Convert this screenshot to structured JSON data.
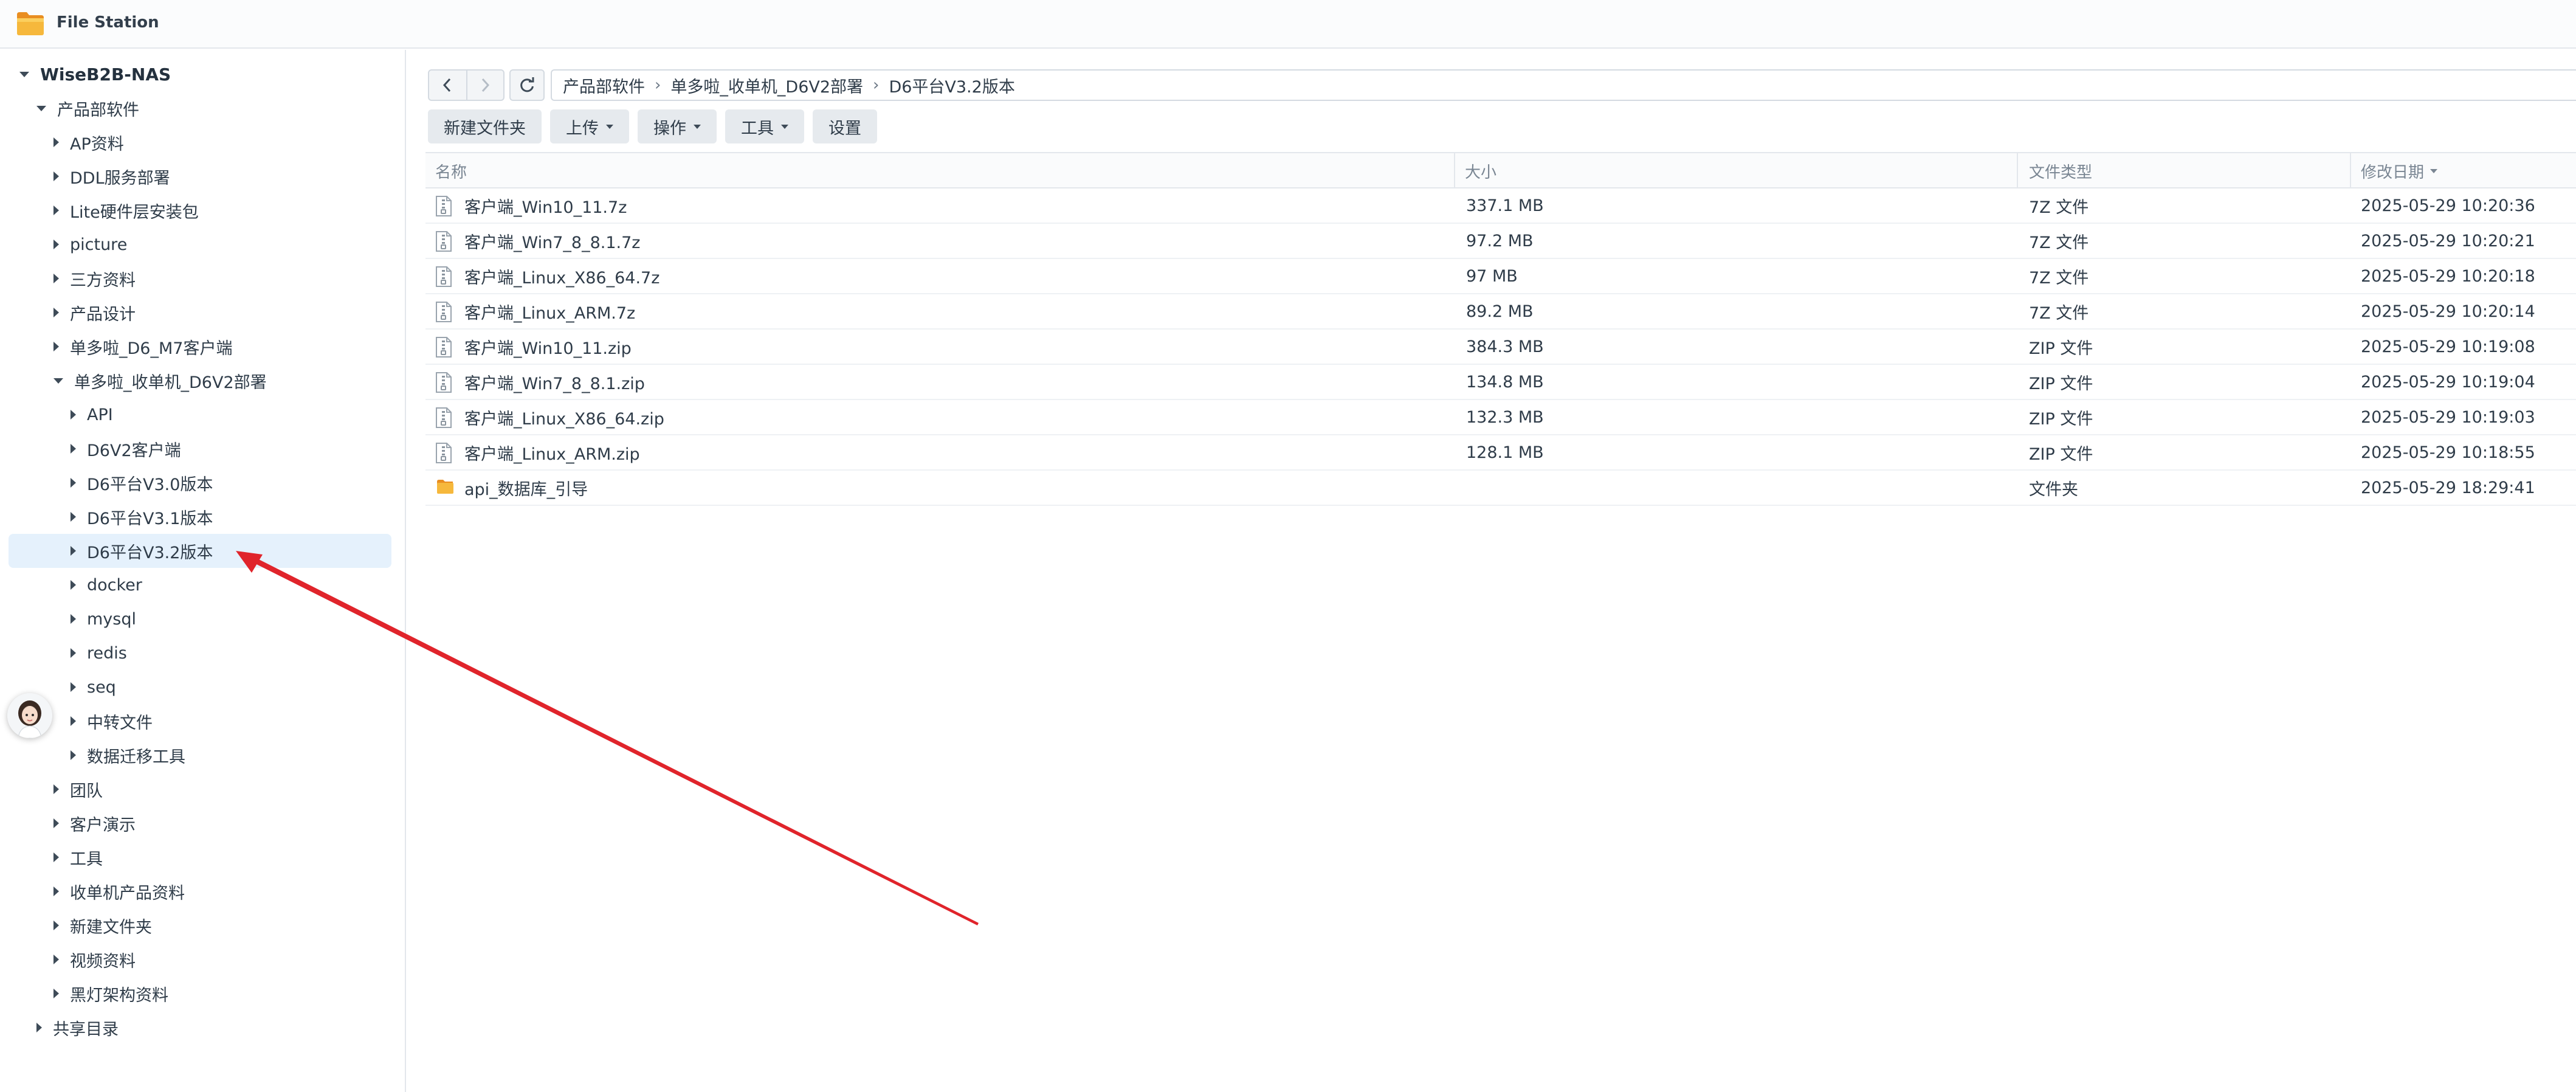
{
  "app": {
    "title": "File Station",
    "icon": "folder-icon",
    "accent_color": "#f3a33b",
    "selection_color": "#e5f1fc",
    "annotation_color": "#e0242b"
  },
  "sidebar": {
    "root": "WiseB2B-NAS",
    "items": [
      {
        "label": "产品部软件",
        "state": "expanded"
      },
      {
        "label": "AP资料",
        "state": "collapsed"
      },
      {
        "label": "DDL服务部署",
        "state": "collapsed"
      },
      {
        "label": "Lite硬件层安装包",
        "state": "collapsed"
      },
      {
        "label": "picture",
        "state": "collapsed"
      },
      {
        "label": "三方资料",
        "state": "collapsed"
      },
      {
        "label": "产品设计",
        "state": "collapsed"
      },
      {
        "label": "单多啦_D6_M7客户端",
        "state": "collapsed"
      },
      {
        "label": "单多啦_收单机_D6V2部署",
        "state": "expanded"
      },
      {
        "label": "API",
        "state": "collapsed"
      },
      {
        "label": "D6V2客户端",
        "state": "collapsed"
      },
      {
        "label": "D6平台V3.0版本",
        "state": "collapsed"
      },
      {
        "label": "D6平台V3.1版本",
        "state": "collapsed"
      },
      {
        "label": "D6平台V3.2版本",
        "state": "collapsed",
        "selected": true
      },
      {
        "label": "docker",
        "state": "collapsed"
      },
      {
        "label": "mysql",
        "state": "collapsed"
      },
      {
        "label": "redis",
        "state": "collapsed"
      },
      {
        "label": "seq",
        "state": "collapsed"
      },
      {
        "label": "中转文件",
        "state": "collapsed"
      },
      {
        "label": "数据迁移工具",
        "state": "collapsed"
      },
      {
        "label": "团队",
        "state": "collapsed"
      },
      {
        "label": "客户演示",
        "state": "collapsed"
      },
      {
        "label": "工具",
        "state": "collapsed"
      },
      {
        "label": "收单机产品资料",
        "state": "collapsed"
      },
      {
        "label": "新建文件夹",
        "state": "collapsed"
      },
      {
        "label": "视频资料",
        "state": "collapsed"
      },
      {
        "label": "黑灯架构资料",
        "state": "collapsed"
      },
      {
        "label": "共享目录",
        "state": "collapsed"
      }
    ]
  },
  "toolbar": {
    "back_icon": "chevron-left-icon",
    "forward_icon": "chevron-right-icon",
    "refresh_icon": "refresh-icon",
    "breadcrumb": [
      "产品部软件",
      "单多啦_收单机_D6V2部署",
      "D6平台V3.2版本"
    ],
    "actions": [
      {
        "label": "新建文件夹",
        "dropdown": false
      },
      {
        "label": "上传",
        "dropdown": true
      },
      {
        "label": "操作",
        "dropdown": true
      },
      {
        "label": "工具",
        "dropdown": true
      },
      {
        "label": "设置",
        "dropdown": false
      }
    ]
  },
  "table": {
    "columns": [
      "名称",
      "大小",
      "文件类型",
      "修改日期"
    ],
    "sort_column": "修改日期",
    "rows": [
      {
        "name": "客户端_Win10_11.7z",
        "size": "337.1 MB",
        "type": "7Z 文件",
        "modified": "2025-05-29 10:20:36",
        "icon": "archive-file-icon"
      },
      {
        "name": "客户端_Win7_8_8.1.7z",
        "size": "97.2 MB",
        "type": "7Z 文件",
        "modified": "2025-05-29 10:20:21",
        "icon": "archive-file-icon"
      },
      {
        "name": "客户端_Linux_X86_64.7z",
        "size": "97 MB",
        "type": "7Z 文件",
        "modified": "2025-05-29 10:20:18",
        "icon": "archive-file-icon"
      },
      {
        "name": "客户端_Linux_ARM.7z",
        "size": "89.2 MB",
        "type": "7Z 文件",
        "modified": "2025-05-29 10:20:14",
        "icon": "archive-file-icon"
      },
      {
        "name": "客户端_Win10_11.zip",
        "size": "384.3 MB",
        "type": "ZIP 文件",
        "modified": "2025-05-29 10:19:08",
        "icon": "archive-file-icon"
      },
      {
        "name": "客户端_Win7_8_8.1.zip",
        "size": "134.8 MB",
        "type": "ZIP 文件",
        "modified": "2025-05-29 10:19:04",
        "icon": "archive-file-icon"
      },
      {
        "name": "客户端_Linux_X86_64.zip",
        "size": "132.3 MB",
        "type": "ZIP 文件",
        "modified": "2025-05-29 10:19:03",
        "icon": "archive-file-icon"
      },
      {
        "name": "客户端_Linux_ARM.zip",
        "size": "128.1 MB",
        "type": "ZIP 文件",
        "modified": "2025-05-29 10:18:55",
        "icon": "archive-file-icon"
      },
      {
        "name": "api_数据库_引导",
        "size": "",
        "type": "文件夹",
        "modified": "2025-05-29 18:29:41",
        "icon": "folder-icon"
      }
    ]
  },
  "overlay": {
    "avatar_icon": "avatar-icon",
    "arrow_icon": "annotation-arrow-icon"
  }
}
